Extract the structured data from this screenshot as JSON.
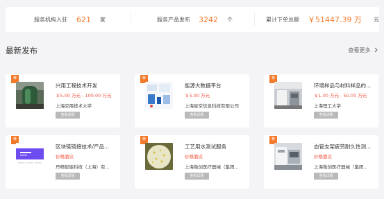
{
  "stats": [
    {
      "label": "服务机构入驻",
      "value": "621",
      "unit": "家"
    },
    {
      "label": "服务产品发布",
      "value": "3242",
      "unit": "个"
    },
    {
      "label": "累计下单总额",
      "value": "￥51447.39 万",
      "unit": "元"
    }
  ],
  "section": {
    "title": "最新发布",
    "more": "查看更多"
  },
  "ribbon_label": "荐",
  "detail_button": "查看详情",
  "cards": [
    {
      "title": "兴用工程技术开发",
      "price": "￥5.00 万元 - 100.00 万元",
      "org": "上海应用技术大学"
    },
    {
      "title": "能源大数据平台",
      "price": "￥5.00 万元",
      "org": "上海星空信息科技有限公司"
    },
    {
      "title": "环境样品与材料样品的...",
      "price": "￥1.00 万元 - 50.00 万元",
      "org": "上海理工大学"
    },
    {
      "title": "区块链链接技术/产品...",
      "price": "价格面议",
      "org": "丹畅智能科技（上海）有..."
    },
    {
      "title": "工艺用水测试服务",
      "price": "价格面议",
      "org": "上海微创医疗器械（集团..."
    },
    {
      "title": "血管支架疲劳耐久性测...",
      "price": "价格面议",
      "org": "上海微创医疗器械（集团..."
    }
  ]
}
